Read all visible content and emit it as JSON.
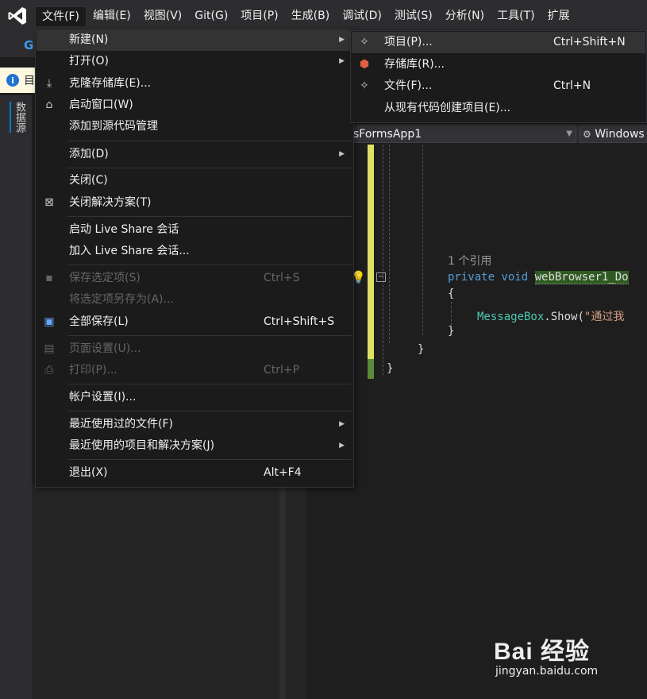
{
  "menubar": {
    "items": [
      "文件(F)",
      "编辑(E)",
      "视图(V)",
      "Git(G)",
      "项目(P)",
      "生成(B)",
      "调试(D)",
      "测试(S)",
      "分析(N)",
      "工具(T)",
      "扩展"
    ],
    "open_index": 0
  },
  "infobar": {
    "text": "目"
  },
  "sidebar": {
    "tab_label": "数据源"
  },
  "file_menu": {
    "items": [
      {
        "label": "新建(N)",
        "submenu": true,
        "icon": "none"
      },
      {
        "label": "打开(O)",
        "submenu": true,
        "icon": "none"
      },
      {
        "label": "克隆存储库(E)...",
        "icon": "clone-icon"
      },
      {
        "label": "启动窗口(W)",
        "icon": "start-window-icon"
      },
      {
        "label": "添加到源代码管理",
        "icon": "none"
      },
      {
        "label": "添加(D)",
        "submenu": true,
        "icon": "none"
      },
      {
        "label": "关闭(C)",
        "icon": "none"
      },
      {
        "label": "关闭解决方案(T)",
        "icon": "close-solution-icon"
      },
      {
        "label": "启动 Live Share 会话",
        "icon": "none"
      },
      {
        "label": "加入 Live Share 会话...",
        "icon": "none"
      },
      {
        "label": "保存选定项(S)",
        "shortcut": "Ctrl+S",
        "disabled": true,
        "icon": "save-icon"
      },
      {
        "label": "将选定项另存为(A)...",
        "disabled": true,
        "icon": "none"
      },
      {
        "label": "全部保存(L)",
        "shortcut": "Ctrl+Shift+S",
        "icon": "save-all-icon"
      },
      {
        "label": "页面设置(U)...",
        "disabled": true,
        "icon": "page-setup-icon"
      },
      {
        "label": "打印(P)...",
        "shortcut": "Ctrl+P",
        "disabled": true,
        "icon": "print-icon"
      },
      {
        "label": "帐户设置(I)...",
        "icon": "none"
      },
      {
        "label": "最近使用过的文件(F)",
        "submenu": true,
        "icon": "none"
      },
      {
        "label": "最近使用的项目和解决方案(J)",
        "submenu": true,
        "icon": "none"
      },
      {
        "label": "退出(X)",
        "shortcut": "Alt+F4",
        "icon": "none"
      }
    ]
  },
  "new_submenu": {
    "items": [
      {
        "label": "项目(P)...",
        "shortcut": "Ctrl+Shift+N",
        "icon": "new-project-icon"
      },
      {
        "label": "存储库(R)...",
        "icon": "repository-icon"
      },
      {
        "label": "文件(F)...",
        "shortcut": "Ctrl+N",
        "icon": "new-file-icon"
      },
      {
        "label": "从现有代码创建项目(E)...",
        "icon": "none"
      }
    ]
  },
  "editor": {
    "nav_project": "sFormsApp1",
    "nav_class": "Windows",
    "references": "1 个引用",
    "line_signature_kw": "private void",
    "line_signature_name": "webBrowser1_Do",
    "open_brace": "{",
    "call_class": "MessageBox",
    "call_dot": ".",
    "call_method": "Show",
    "call_paren": "(",
    "call_string": "\"通过我",
    "close_brace": "}",
    "outer_close_brace": "}",
    "ns_close_brace": "}"
  },
  "watermark": {
    "brand": "Bai 经验",
    "url": "jingyan.baidu.com"
  },
  "colors": {
    "chrome": "#2d2d30",
    "menu_bg": "#1b1b1c",
    "highlight": "#333334",
    "keyword": "#569cd6",
    "type": "#4ec9b0",
    "string": "#d69d85",
    "selection": "#2f5a22",
    "change_bar": "#e0e064"
  }
}
